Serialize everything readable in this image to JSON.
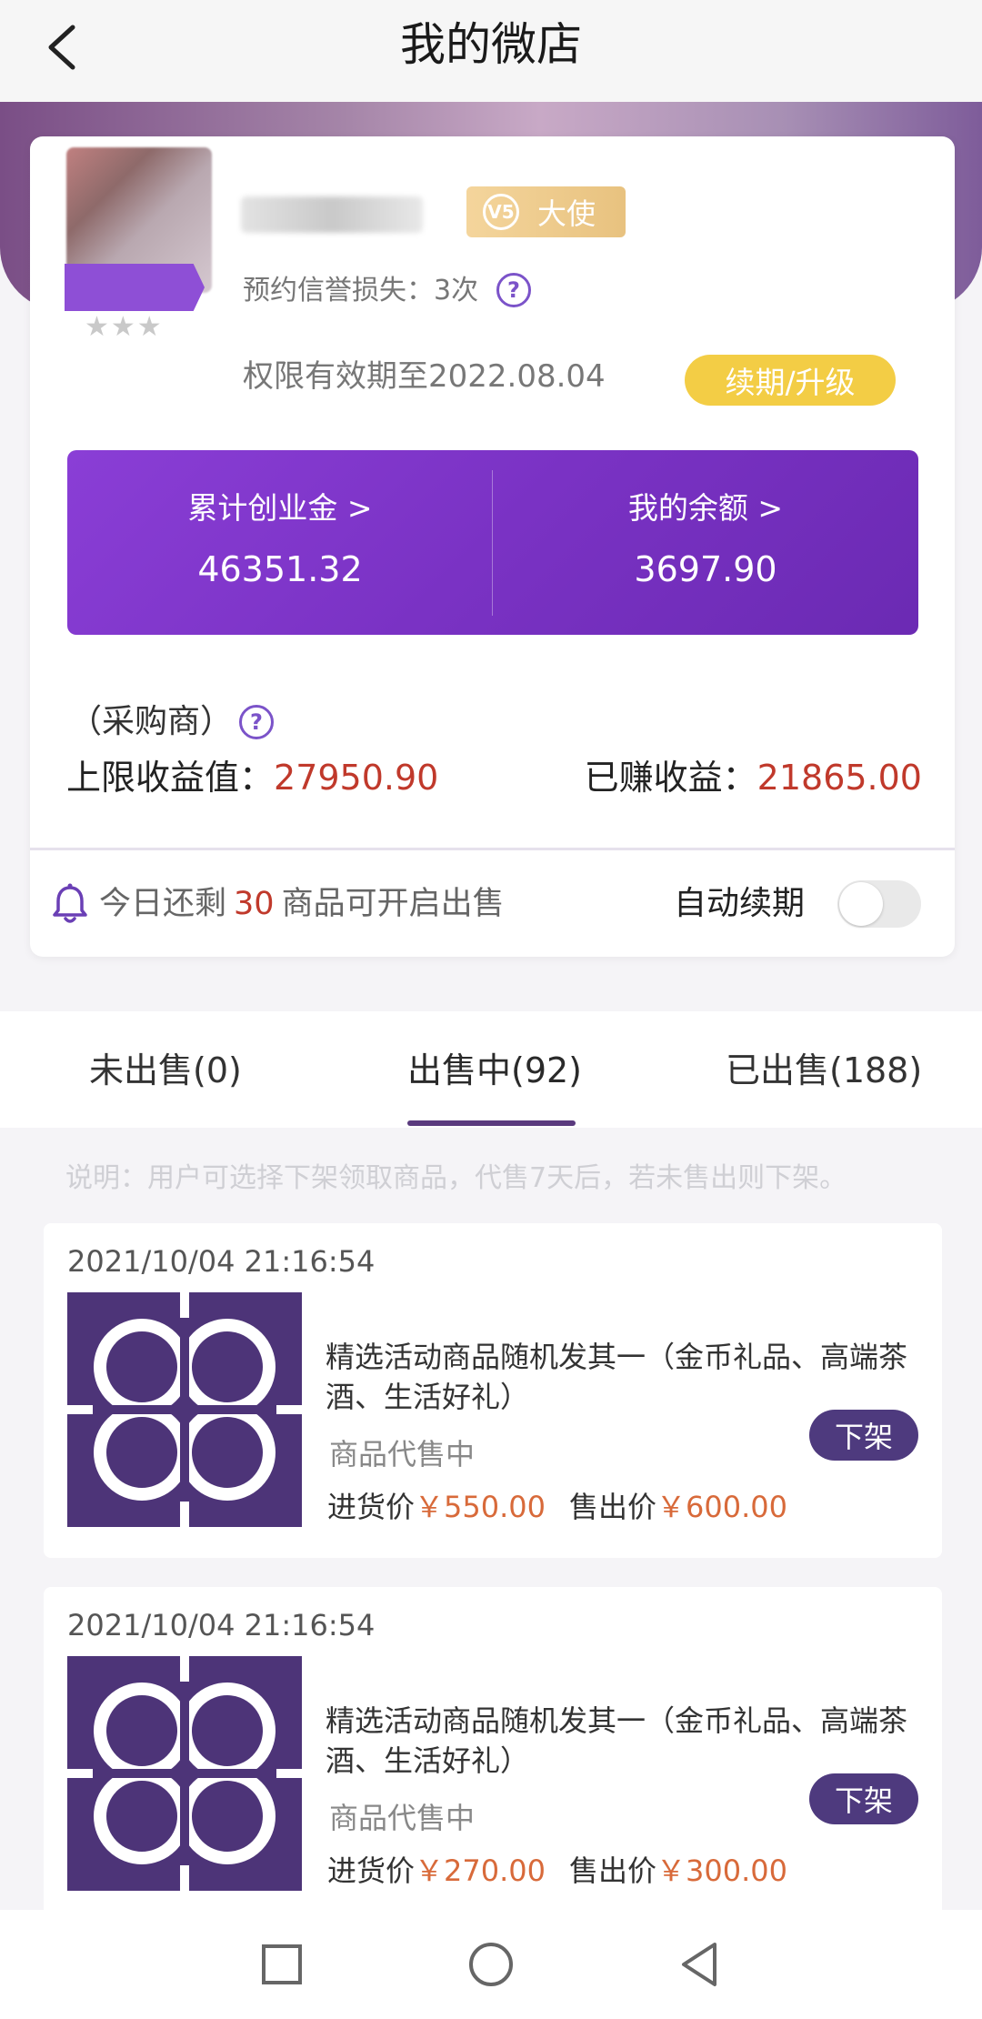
{
  "header": {
    "title": "我的微店"
  },
  "profile": {
    "level_badge": "大使",
    "level_badge_icon_text": "V5",
    "credit_loss": "预约信誉损失：3次",
    "validity": "权限有效期至2022.08.04",
    "renew_button": "续期/升级"
  },
  "balances": [
    {
      "label": "累计创业金 >",
      "value": "46351.32"
    },
    {
      "label": "我的余额 >",
      "value": "3697.90"
    }
  ],
  "earnings": {
    "buyer_label": "（采购商）",
    "limit_label": "上限收益值：",
    "limit_value": "27950.90",
    "earned_label": "已赚收益：",
    "earned_value": "21865.00"
  },
  "reminder": {
    "prefix": "今日还剩",
    "count": "30",
    "suffix": "商品可开启出售",
    "auto_renew_label": "自动续期",
    "auto_renew_on": false
  },
  "tabs": [
    {
      "label": "未出售(0)",
      "active": false
    },
    {
      "label": "出售中(92)",
      "active": true
    },
    {
      "label": "已出售(188)",
      "active": false
    }
  ],
  "notice": "说明：用户可选择下架领取商品，代售7天后，若未售出则下架。",
  "orders": [
    {
      "time": "2021/10/04 21:16:54",
      "title": "精选活动商品随机发其一（金币礼品、高端茶酒、生活好礼）",
      "status": "商品代售中",
      "cost_label": "进货价",
      "cost_price": "￥550.00",
      "sale_label": "售出价",
      "sale_price": "￥600.00",
      "action": "下架"
    },
    {
      "time": "2021/10/04 21:16:54",
      "title": "精选活动商品随机发其一（金币礼品、高端茶酒、生活好礼）",
      "status": "商品代售中",
      "cost_label": "进货价",
      "cost_price": "￥270.00",
      "sale_label": "售出价",
      "sale_price": "￥300.00",
      "action": "下架"
    }
  ],
  "colors": {
    "brand_purple": "#7a32c4",
    "accent_red": "#c0392b",
    "price_orange": "#d86a3a",
    "renew_yellow": "#f3cd45",
    "button_purple": "#4e3a7e"
  },
  "icons": [
    "back-arrow-icon",
    "help-icon",
    "bell-icon",
    "clover-logo-icon",
    "nav-recent-icon",
    "nav-home-icon",
    "nav-back-icon"
  ]
}
